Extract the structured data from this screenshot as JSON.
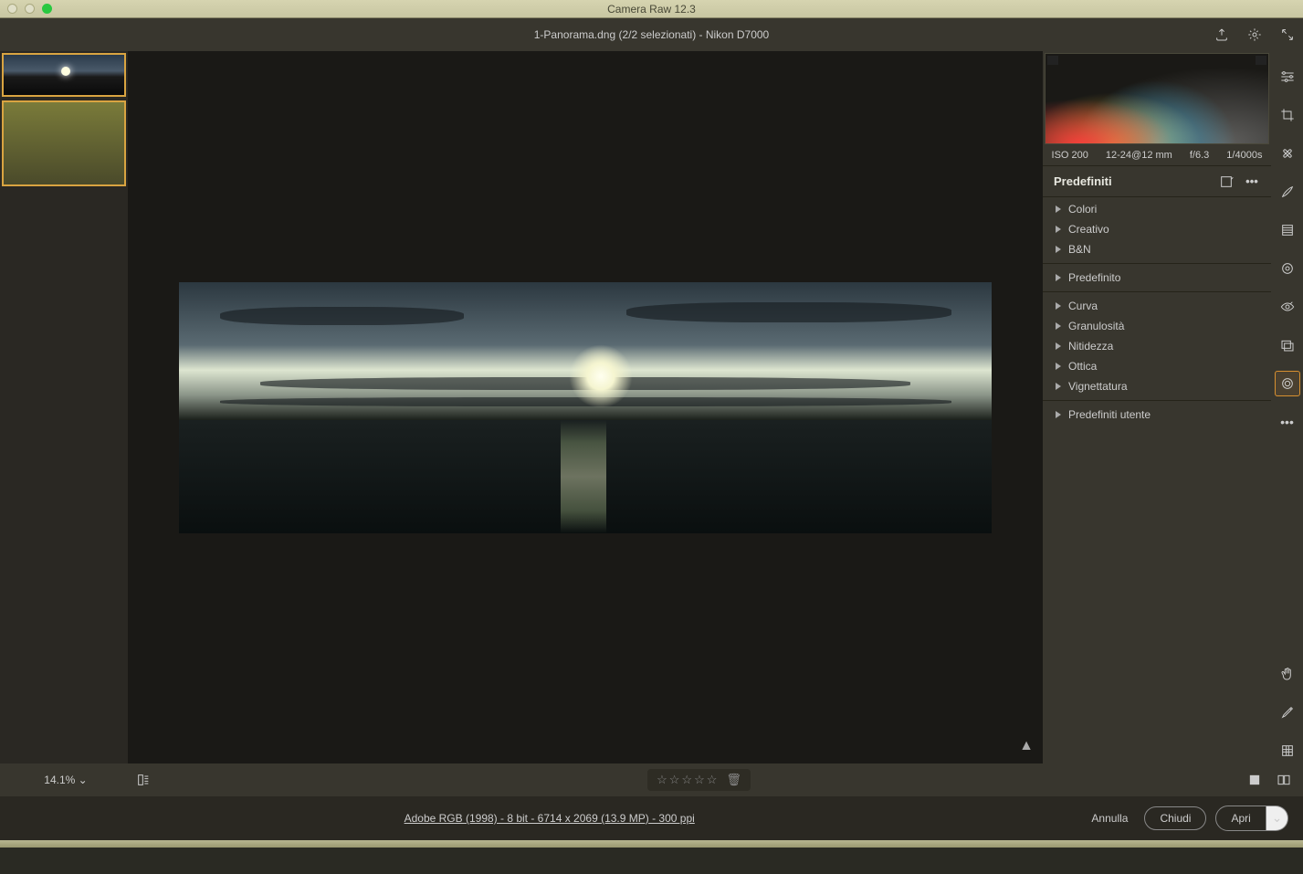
{
  "app": {
    "title": "Camera Raw 12.3"
  },
  "header": {
    "filename": "1-Panorama.dng (2/2 selezionati)  -  Nikon D7000"
  },
  "exif": {
    "iso": "ISO 200",
    "lens": "12-24@12 mm",
    "aperture": "f/6.3",
    "shutter": "1/4000s"
  },
  "panel": {
    "title": "Predefiniti",
    "groups1": [
      "Colori",
      "Creativo",
      "B&N"
    ],
    "groups2": [
      "Predefinito"
    ],
    "groups3": [
      "Curva",
      "Granulosità",
      "Nitidezza",
      "Ottica",
      "Vignettatura"
    ],
    "groups4": [
      "Predefiniti utente"
    ]
  },
  "zoom": "14.1%",
  "footer": {
    "link": "Adobe RGB (1998) - 8 bit - 6714 x 2069 (13.9 MP) - 300 ppi",
    "cancel": "Annulla",
    "close": "Chiudi",
    "open": "Apri"
  }
}
